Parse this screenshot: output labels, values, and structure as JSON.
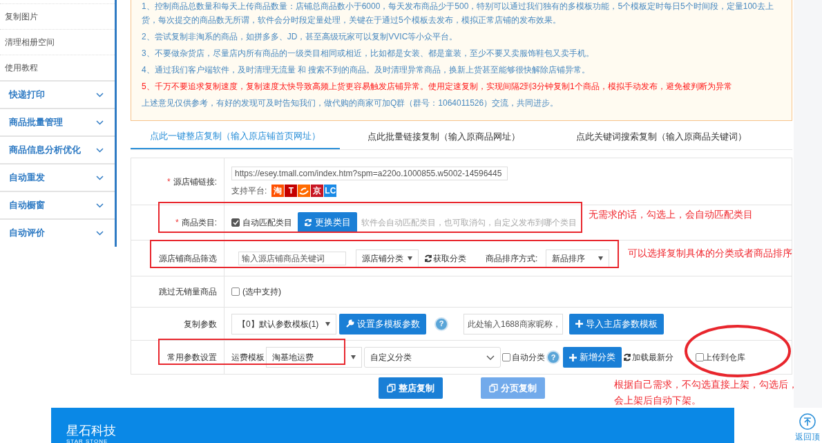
{
  "sidebar": {
    "links": [
      {
        "label": "复制图片"
      },
      {
        "label": "清理相册空间"
      },
      {
        "label": "使用教程"
      }
    ],
    "groups": [
      {
        "label": "快递打印",
        "expanded": false
      },
      {
        "label": "商品批量管理",
        "expanded": false
      },
      {
        "label": "商品信息分析优化",
        "expanded": false
      },
      {
        "label": "自动重发",
        "expanded": false
      },
      {
        "label": "自动橱窗",
        "expanded": false
      },
      {
        "label": "自动评价",
        "expanded": false
      }
    ]
  },
  "notice": {
    "lines": [
      {
        "kind": "normal",
        "text": "1、控制商品总数量和每天上传商品数量：店铺总商品数小于6000，每天发布商品少于500，特别可以通过我们独有的多模板功能，5个模板定时每日5个时间段，定量100去上货，每次提交的商品数无所谓，软件会分时段定量处理，关键在于通过5个模板去发布，模拟正常店铺的发布效果。"
      },
      {
        "kind": "normal",
        "text": "2、尝试复制非淘系的商品，如拼多多、JD，甚至高级玩家可以复制VVIC等小众平台。"
      },
      {
        "kind": "normal",
        "text": "3、不要做杂货店，尽量店内所有商品的一级类目相同或相近，比如都是女装、都是童装，至少不要又卖服饰鞋包又卖手机。"
      },
      {
        "kind": "normal",
        "text": "4、通过我们客户端软件，及时清理无流量 和 搜索不到的商品。及时清理异常商品，换新上货甚至能够很快解除店铺异常。"
      },
      {
        "kind": "warning",
        "text": "5、千万不要追求复制速度，复制速度太快导致高频上货更容易触发店铺异常。使用定速复制，实现间隔2到3分钟复制1个商品，模拟手动发布，避免被判断为异常"
      },
      {
        "kind": "normal",
        "text": "上述意见仅供参考，有好的发现可及时告知我们，做代购的商家可加Q群（群号：1064011526）交流，共同进步。"
      }
    ]
  },
  "tabs": [
    {
      "label": "点此一键整店复制（输入原店铺首页网址）",
      "selected": true
    },
    {
      "label": "点此批量链接复制（输入原商品网址）",
      "selected": false
    },
    {
      "label": "点此关键词搜索复制（输入原商品关键词）",
      "selected": false
    }
  ],
  "form": {
    "source": {
      "label": "源店铺链接:",
      "required_mark": "*",
      "value": "https://esey.tmall.com/index.htm?spm=a220o.1000855.w5002-14596445",
      "platforms_label": "支持平台:",
      "platforms": [
        {
          "kind": "text",
          "label": "淘",
          "color": "#ff5000"
        },
        {
          "kind": "text",
          "label": "T",
          "color": "#c40000"
        },
        {
          "kind": "logo",
          "color": "#ff6a00"
        },
        {
          "kind": "text",
          "label": "京",
          "color": "#c81623"
        },
        {
          "kind": "text",
          "label": "LC",
          "color": "#1a8ae6"
        }
      ]
    },
    "category": {
      "label": "商品类目:",
      "required_mark": "*",
      "auto_label": "自动匹配类目",
      "auto_checked": true,
      "button": "更换类目",
      "hint": "软件会自动匹配类目，也可取消勾，自定义发布到哪个类目"
    },
    "filter": {
      "label": "源店铺商品筛选",
      "keyword_placeholder": "输入源店铺商品关键词",
      "category_select": "源店铺分类",
      "fetch_button": "获取分类",
      "sort_label": "商品排序方式:",
      "sort_select": "新品排序"
    },
    "skip": {
      "label": "跳过无销量商品",
      "option": "(选中支持)",
      "checked": false
    },
    "params": {
      "label": "复制参数",
      "template_select": "【0】默认参数模板(1)",
      "settings_button": "设置多模板参数",
      "help": "?",
      "nick_placeholder": "此处输入1688商家昵称，",
      "import_button": "导入主店参数模板"
    },
    "common": {
      "label": "常用参数设置",
      "shipping_label": "运费模板",
      "shipping_select": "淘基地运费",
      "custom_select": "自定义分类",
      "auto_label": "自动分类",
      "auto_checked": false,
      "help": "?",
      "add_button": "新增分类",
      "reload_button": "加载最新分",
      "upload_label": "上传到仓库",
      "upload_checked": false
    }
  },
  "actions": [
    {
      "label": "整店复制",
      "disabled": false
    },
    {
      "label": "分页复制",
      "disabled": true
    }
  ],
  "annotations": [
    {
      "text": "无需求的话，勾选上，会自动匹配类目"
    },
    {
      "text": "可以选择复制具体的分类或者商品排序"
    },
    {
      "text": "根据自己需求，不勾选直接上架，勾选后，会上架后自动下架。"
    }
  ],
  "footer": {
    "brand": "星石科技",
    "brand_en": "STAR STONE"
  },
  "back_to_top": {
    "label": "返回顶"
  }
}
